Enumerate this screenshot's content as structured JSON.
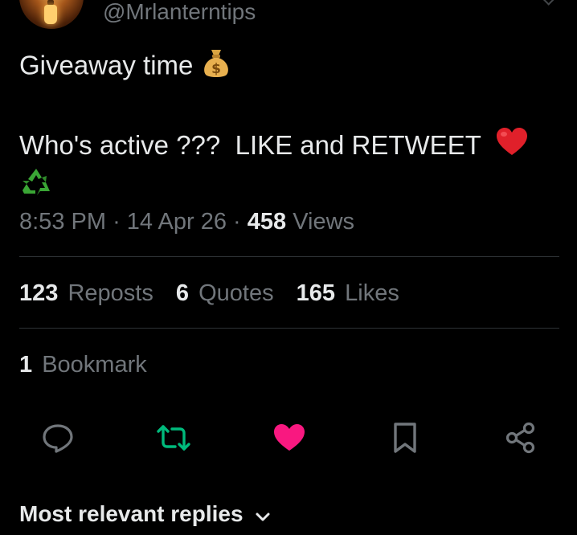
{
  "author": {
    "handle": "@Mrlanterntips",
    "avatar_icon": "lantern-avatar"
  },
  "tweet": {
    "line1": "Giveaway time",
    "line1_emoji": "money-bag-icon",
    "line2": "Who's active ???  LIKE and RETWEET",
    "line2_emoji": "red-heart-icon",
    "line3_emoji": "recycling-icon"
  },
  "meta": {
    "time": "8:53 PM",
    "separator": "·",
    "date": "14 Apr 26",
    "views_count": "458",
    "views_label": "Views"
  },
  "stats": {
    "reposts_count": "123",
    "reposts_label": "Reposts",
    "quotes_count": "6",
    "quotes_label": "Quotes",
    "likes_count": "165",
    "likes_label": "Likes"
  },
  "bookmarks": {
    "count": "1",
    "label": "Bookmark"
  },
  "actions": [
    {
      "name": "reply",
      "icon": "reply-bubble-icon",
      "color": "#71767b"
    },
    {
      "name": "repost",
      "icon": "repost-icon",
      "color": "#00ba7c",
      "active": true
    },
    {
      "name": "like",
      "icon": "heart-icon",
      "color": "#f91880",
      "active": true
    },
    {
      "name": "bookmark",
      "icon": "bookmark-icon",
      "color": "#71767b"
    },
    {
      "name": "share",
      "icon": "share-icon",
      "color": "#71767b"
    }
  ],
  "replies": {
    "sort_label": "Most relevant replies"
  },
  "colors": {
    "background": "#000000",
    "text_primary": "#e7e9ea",
    "text_secondary": "#71767b",
    "divider": "#2f3336",
    "repost_active": "#00ba7c",
    "like_active": "#f91880"
  }
}
